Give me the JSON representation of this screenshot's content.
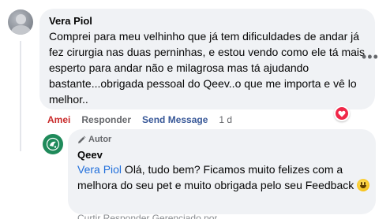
{
  "comment": {
    "author": "Vera Piol",
    "text": "Comprei para meu velhinho que já tem dificuldades de andar já fez cirurgia nas duas perninhas, e estou vendo como ele tá mais esperto para andar não e milagrosa mas tá ajudando bastante...obrigada pessoal do Qeev..o que me importa e vê lo melhor..",
    "actions": {
      "like": "Amei",
      "reply": "Responder",
      "send_message": "Send Message",
      "time": "1 d"
    },
    "reaction_icon": "heart-icon",
    "reaction_color": "#f02849"
  },
  "reply": {
    "badge": "Autor",
    "badge_icon": "pen-icon",
    "author": "Qeev",
    "mention": "Vera Piol",
    "text": " Olá, tudo bem? Ficamos muito felizes com a melhora do seu pet e muito obrigada pelo seu Feedback ",
    "emoji": "grinning-face-icon",
    "cut_text": "Curtir   Responder   Gerenciado por"
  },
  "colors": {
    "bubble": "#f0f2f5",
    "like_active": "#c92b2b",
    "link": "#385898",
    "mention": "#216fdb",
    "brand_avatar": "#1f8a5a"
  }
}
